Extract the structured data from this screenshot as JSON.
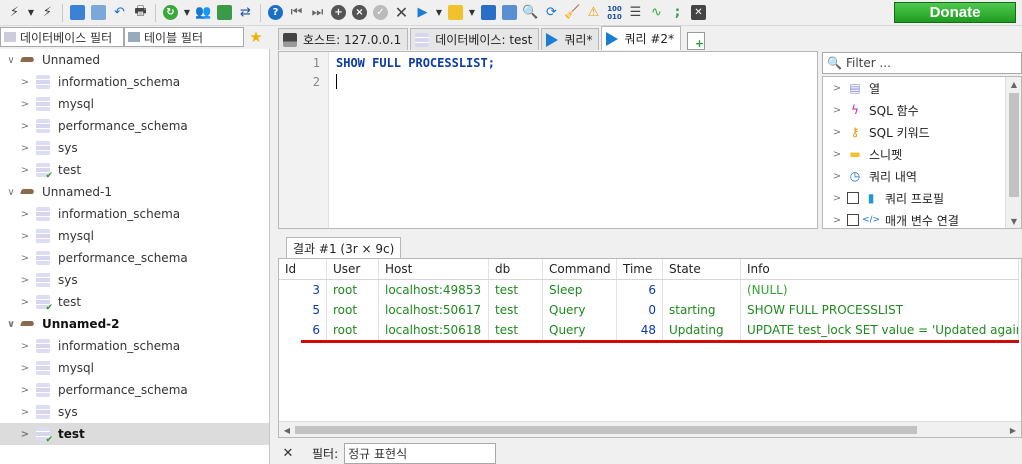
{
  "toolbar": {
    "donate_label": "Donate",
    "icons": [
      "connect-icon",
      "disconnect-icon",
      "copy-icon",
      "paste-icon",
      "undo-icon",
      "print-icon",
      "refresh-icon",
      "user-manager-icon",
      "export-icon",
      "transfer-icon",
      "help-icon",
      "first-icon",
      "last-icon",
      "add-icon",
      "delete-icon",
      "apply-icon",
      "cancel-icon",
      "run-icon",
      "open-folder-icon",
      "save-icon",
      "query-icon",
      "find-icon",
      "replace-icon",
      "clean-icon",
      "warning-icon",
      "binary-icon",
      "wrap-icon",
      "sync-icon",
      "separator-icon",
      "close-icon"
    ]
  },
  "left_filters": {
    "db_filter": "데이터베이스 필터",
    "table_filter": "테이블 필터"
  },
  "tree": {
    "servers": [
      {
        "name": "Unnamed",
        "bold": false,
        "dbs": [
          "information_schema",
          "mysql",
          "performance_schema",
          "sys",
          "test"
        ],
        "active_db": "test",
        "selected_db": ""
      },
      {
        "name": "Unnamed-1",
        "bold": false,
        "dbs": [
          "information_schema",
          "mysql",
          "performance_schema",
          "sys",
          "test"
        ],
        "active_db": "test",
        "selected_db": ""
      },
      {
        "name": "Unnamed-2",
        "bold": true,
        "dbs": [
          "information_schema",
          "mysql",
          "performance_schema",
          "sys",
          "test"
        ],
        "active_db": "test",
        "selected_db": "test"
      }
    ]
  },
  "tabs": [
    {
      "label": "호스트: 127.0.0.1",
      "icon": "host",
      "active": false
    },
    {
      "label": "데이터베이스: test",
      "icon": "db",
      "active": false
    },
    {
      "label": "쿼리*",
      "icon": "play",
      "active": false
    },
    {
      "label": "쿼리 #2*",
      "icon": "play",
      "active": true
    }
  ],
  "editor": {
    "line_numbers": [
      "1",
      "2"
    ],
    "code": "SHOW FULL PROCESSLIST;"
  },
  "helper": {
    "filter_placeholder": "Filter ...",
    "items": [
      {
        "label": "열",
        "icon": "columns-icon",
        "checkbox": false
      },
      {
        "label": "SQL 함수",
        "icon": "function-icon",
        "checkbox": false
      },
      {
        "label": "SQL 키워드",
        "icon": "key-icon",
        "checkbox": false
      },
      {
        "label": "스니펫",
        "icon": "folder-icon",
        "checkbox": false
      },
      {
        "label": "쿼리 내역",
        "icon": "clock-icon",
        "checkbox": false
      },
      {
        "label": "쿼리 프로필",
        "icon": "bar-chart-icon",
        "checkbox": true
      },
      {
        "label": "매개 변수 연결",
        "icon": "code-icon",
        "checkbox": true
      }
    ]
  },
  "results": {
    "tab_label": "결과 #1 (3r × 9c)",
    "columns": [
      "Id",
      "User",
      "Host",
      "db",
      "Command",
      "Time",
      "State",
      "Info"
    ],
    "rows": [
      [
        "3",
        "root",
        "localhost:49853",
        "test",
        "Sleep",
        "6",
        "",
        "(NULL)"
      ],
      [
        "5",
        "root",
        "localhost:50617",
        "test",
        "Query",
        "0",
        "starting",
        "SHOW FULL PROCESSLIST"
      ],
      [
        "6",
        "root",
        "localhost:50618",
        "test",
        "Query",
        "48",
        "Updating",
        "UPDATE test_lock SET value = 'Updated again' WHERE"
      ]
    ]
  },
  "bottom_filter": {
    "label": "필터:",
    "placeholder": "정규 표현식"
  },
  "colors": {
    "keyword": "#0c3ca3",
    "string_cell": "#1e8a1e",
    "number_cell": "#0d3aa8",
    "highlight_line": "#d20a0a",
    "donate": "#2bb52b"
  }
}
